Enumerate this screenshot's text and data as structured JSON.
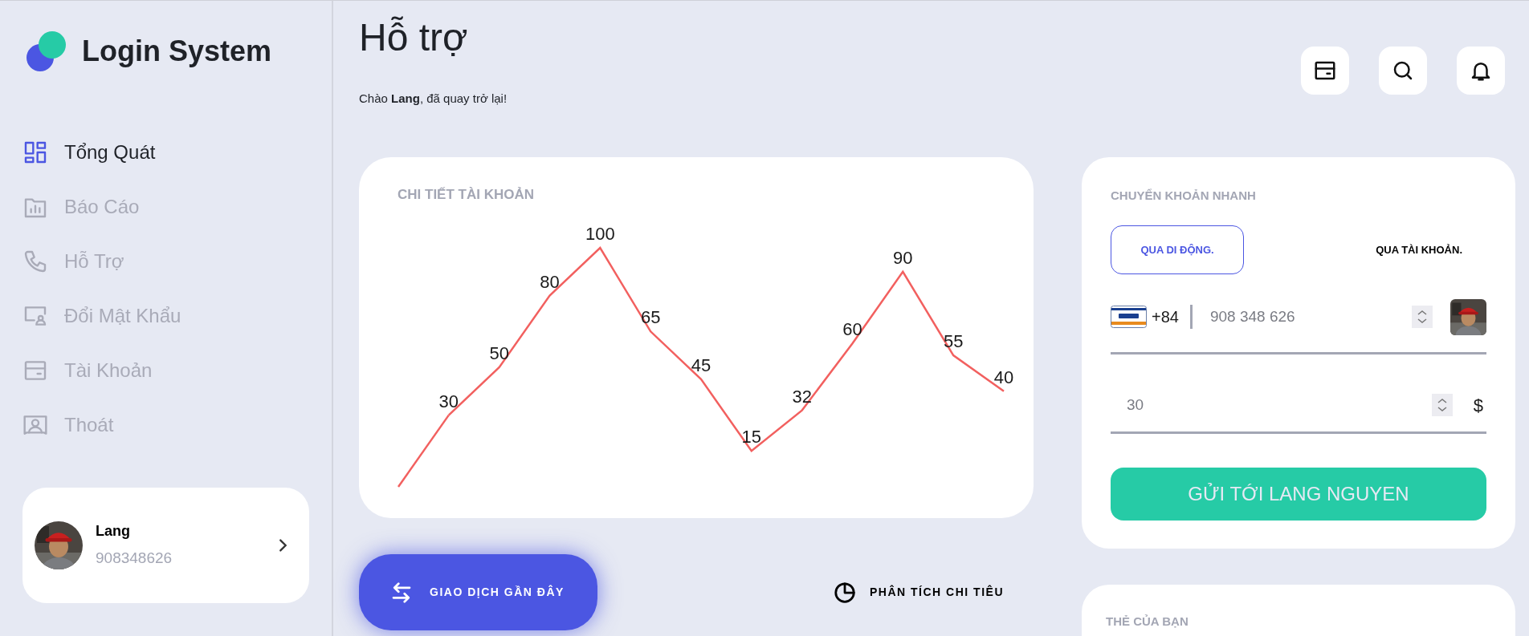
{
  "sidebar": {
    "logo": {
      "title": "Login System"
    },
    "nav": [
      {
        "label": "Tổng Quát",
        "kind": "dashboard",
        "selected": true
      },
      {
        "label": "Báo Cáo",
        "kind": "report",
        "selected": false
      },
      {
        "label": "Hỗ Trợ",
        "kind": "phone",
        "selected": false
      },
      {
        "label": "Đổi Mật Khẩu",
        "kind": "screenuser",
        "selected": false
      },
      {
        "label": "Tài Khoản",
        "kind": "card",
        "selected": false
      },
      {
        "label": "Thoát",
        "kind": "frameuser",
        "selected": false
      }
    ],
    "profile": {
      "name": "Lang",
      "phone": "908348626"
    }
  },
  "header": {
    "title": "Hỗ trợ",
    "greeting": "Chào **Lang**, đã quay trở lại!",
    "toolbar": [
      {
        "kind": "card"
      },
      {
        "kind": "search"
      },
      {
        "kind": "bell"
      }
    ]
  },
  "account_chart": {
    "title": "CHI TIẾT TÀI KHOẢN",
    "chart_data": {
      "type": "line",
      "categories": [
        null,
        null,
        null,
        null,
        null,
        null,
        null,
        null,
        null,
        null,
        null,
        null,
        null
      ],
      "data_labels": true,
      "series": [
        {
          "color": "#f2605f",
          "values": [
            null,
            30,
            50,
            80,
            100,
            65,
            45,
            15,
            32,
            60,
            90,
            55,
            40
          ]
        }
      ]
    }
  },
  "quick_transfer": {
    "title": "CHUYỂN KHOẢN NHANH",
    "tabs": [
      {
        "label": "QUA DI ĐỘNG.",
        "selected": true
      },
      {
        "label": "QUA TÀI KHOẢN.",
        "selected": false
      }
    ],
    "country_code": "+84",
    "phone": "908 348 626",
    "amount": "30",
    "currency": "$",
    "send_button": "GỬI TỚI LANG NGUYEN"
  },
  "bottom_tabs": [
    {
      "label": "GIAO DỊCH GẦN ĐÂY",
      "kind": "swap",
      "selected": true
    },
    {
      "label": "PHÂN TÍCH CHI TIÊU",
      "kind": "pie",
      "selected": false
    }
  ],
  "cards_panel": {
    "title": "THẺ CỦA BẠN"
  }
}
